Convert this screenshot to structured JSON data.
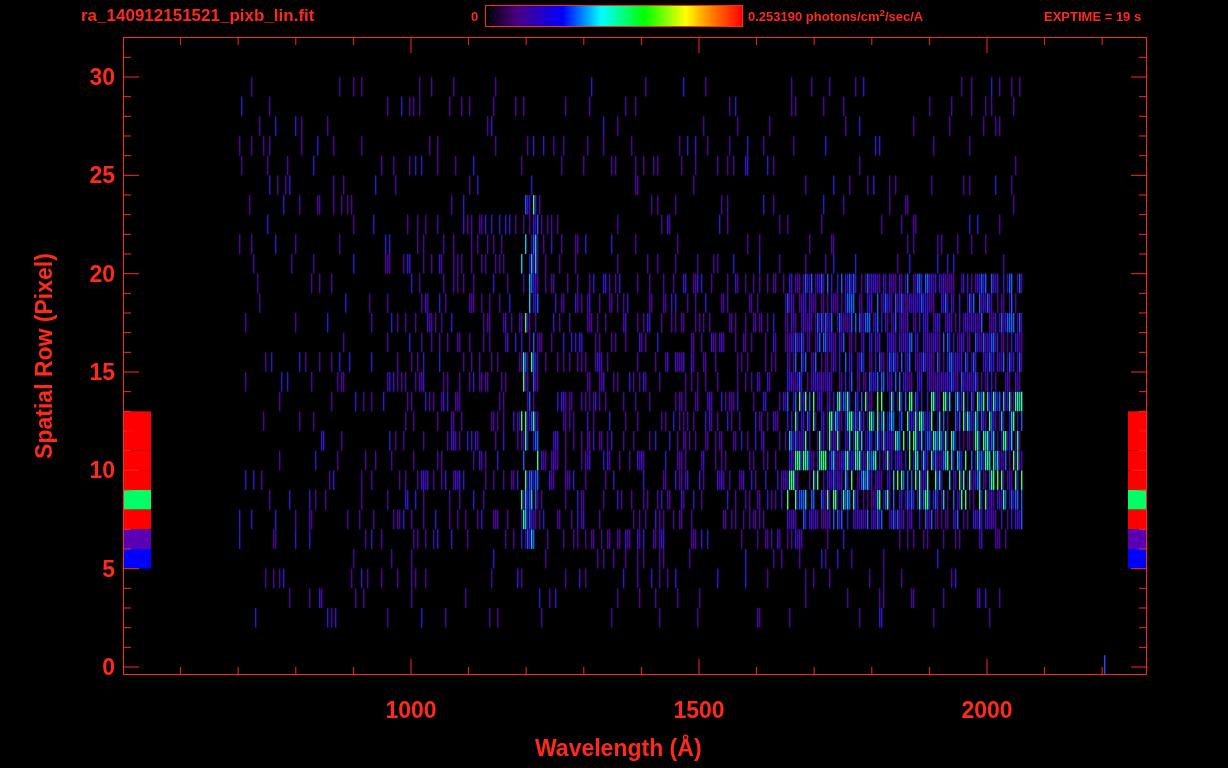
{
  "title": "ra_140912151521_pixb_lin.fit",
  "colorbar": {
    "min_label": "0",
    "max_label": "0.253190 photons/cm$^{2}$/sec/A"
  },
  "exposure": "EXPTIME = 19 s",
  "plot": {
    "x_axis": {
      "label": "Wavelength (Å)",
      "ticks": [
        "1000",
        "1500",
        "2000"
      ]
    },
    "y_axis": {
      "label": "Spatial Row (Pixel)",
      "ticks": [
        "30",
        "25",
        "20",
        "15",
        "10",
        "5",
        "0"
      ]
    },
    "row_bands": [
      {
        "color": "#ff0000"
      },
      {
        "color": "#ff0000"
      },
      {
        "color": "#ff0000"
      },
      {
        "color": "#ff0000"
      },
      {
        "color": "#00ff66"
      },
      {
        "color": "#ff0000"
      },
      {
        "color": "#5a00b4"
      },
      {
        "color": "#0000ff"
      }
    ]
  }
}
